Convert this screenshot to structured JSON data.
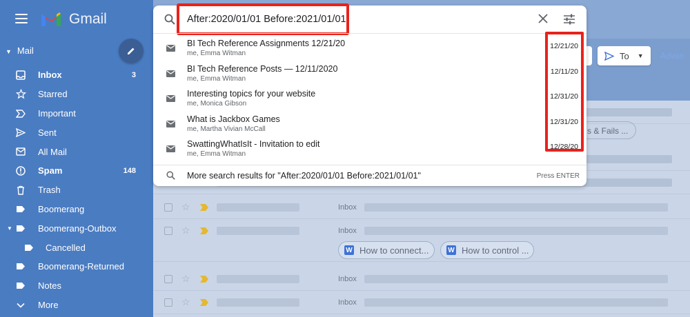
{
  "app": {
    "name": "Gmail"
  },
  "sidebar": {
    "section": "Mail",
    "items": [
      {
        "label": "Inbox",
        "count": "3",
        "icon": "inbox-icon",
        "bold": true
      },
      {
        "label": "Starred",
        "count": "",
        "icon": "star-icon"
      },
      {
        "label": "Important",
        "count": "",
        "icon": "important-icon"
      },
      {
        "label": "Sent",
        "count": "",
        "icon": "send-icon"
      },
      {
        "label": "All Mail",
        "count": "",
        "icon": "all-mail-icon"
      },
      {
        "label": "Spam",
        "count": "148",
        "icon": "spam-icon",
        "bold": true
      },
      {
        "label": "Trash",
        "count": "",
        "icon": "trash-icon"
      },
      {
        "label": "Boomerang",
        "count": "",
        "icon": "label-icon"
      },
      {
        "label": "Boomerang-Outbox",
        "count": "",
        "icon": "label-icon"
      },
      {
        "label": "Cancelled",
        "count": "",
        "icon": "label-icon"
      },
      {
        "label": "Boomerang-Returned",
        "count": "",
        "icon": "label-icon"
      },
      {
        "label": "Notes",
        "count": "",
        "icon": "label-icon"
      },
      {
        "label": "More",
        "count": "",
        "icon": "chevron-down-icon"
      }
    ]
  },
  "search": {
    "query": "After:2020/01/01 Before:2021/01/01",
    "results": [
      {
        "title": "BI Tech Reference Assignments 12/21/20",
        "meta": "me, Emma Witman",
        "date": "12/21/20"
      },
      {
        "title": "BI Tech Reference Posts — 12/11/2020",
        "meta": "me, Emma Witman",
        "date": "12/11/20"
      },
      {
        "title": "Interesting topics for your website",
        "meta": "me, Monica Gibson",
        "date": "12/31/20"
      },
      {
        "title": "What is Jackbox Games",
        "meta": "me, Martha Vivian McCall",
        "date": "12/31/20"
      },
      {
        "title": "SwattingWhatIsIt - Invitation to edit",
        "meta": "me, Emma Witman",
        "date": "12/28/20"
      }
    ],
    "more_text": "More search results for \"After:2020/01/01 Before:2021/01/01\"",
    "press_hint": "Press ENTER"
  },
  "background": {
    "to_label": "To",
    "advanced_label": "Advan",
    "chip_top": "s & Fails ...",
    "inbox_label": "Inbox",
    "chips": [
      "How to connect...",
      "How to control ..."
    ]
  },
  "colors": {
    "highlight": "#e8221a",
    "sidebar": "#4a7cc2",
    "accent": "#1a73e8"
  }
}
